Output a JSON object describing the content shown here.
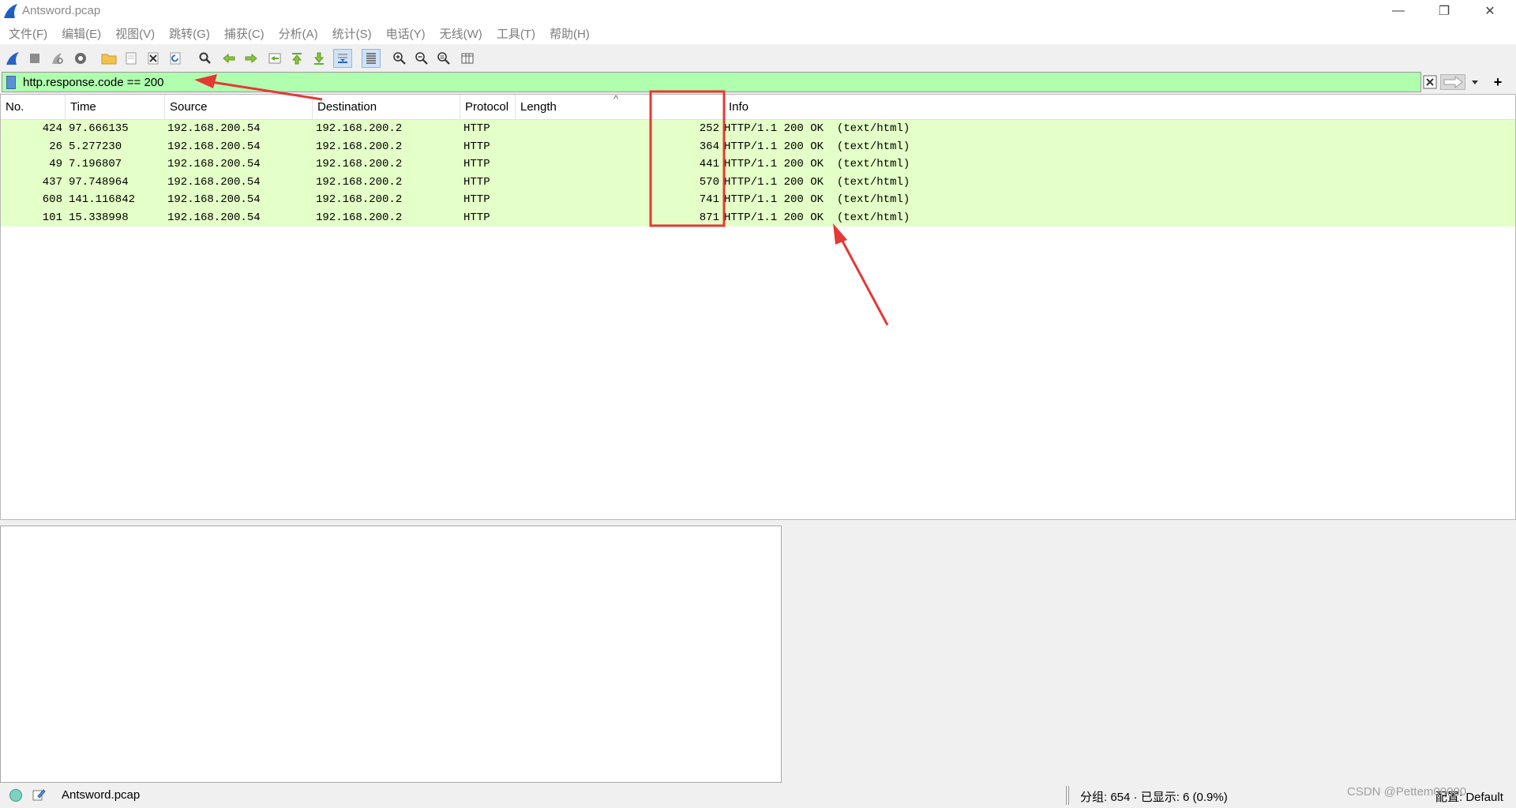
{
  "window": {
    "title": "Antsword.pcap",
    "minimize_glyph": "—",
    "maximize_glyph": "❐",
    "close_glyph": "✕"
  },
  "menu": [
    "文件(F)",
    "编辑(E)",
    "视图(V)",
    "跳转(G)",
    "捕获(C)",
    "分析(A)",
    "统计(S)",
    "电话(Y)",
    "无线(W)",
    "工具(T)",
    "帮助(H)"
  ],
  "toolbar": {
    "icons": [
      "shark-fin-start-icon",
      "stop-square-icon",
      "restart-fin-icon",
      "capture-options-gear-icon",
      "open-folder-icon",
      "save-file-icon",
      "close-file-icon",
      "reload-file-icon",
      "find-magnifier-icon",
      "go-back-arrow-icon",
      "go-forward-arrow-icon",
      "go-to-packet-icon",
      "first-packet-icon",
      "last-packet-icon",
      "autoscroll-icon",
      "colorize-icon",
      "zoom-in-icon",
      "zoom-out-icon",
      "normal-size-icon",
      "resize-columns-icon"
    ]
  },
  "filter": {
    "value": "http.response.code == 200",
    "plus_glyph": "+"
  },
  "packet_list": {
    "headers": [
      "No.",
      "Time",
      "Source",
      "Destination",
      "Protocol",
      "Length",
      "Info"
    ],
    "sort_indicator": "^",
    "rows": [
      {
        "no": "424",
        "time": "97.666135",
        "source": "192.168.200.54",
        "destination": "192.168.200.2",
        "protocol": "HTTP",
        "length": "252",
        "info": "HTTP/1.1 200 OK  (text/html)"
      },
      {
        "no": "26",
        "time": "5.277230",
        "source": "192.168.200.54",
        "destination": "192.168.200.2",
        "protocol": "HTTP",
        "length": "364",
        "info": "HTTP/1.1 200 OK  (text/html)"
      },
      {
        "no": "49",
        "time": "7.196807",
        "source": "192.168.200.54",
        "destination": "192.168.200.2",
        "protocol": "HTTP",
        "length": "441",
        "info": "HTTP/1.1 200 OK  (text/html)"
      },
      {
        "no": "437",
        "time": "97.748964",
        "source": "192.168.200.54",
        "destination": "192.168.200.2",
        "protocol": "HTTP",
        "length": "570",
        "info": "HTTP/1.1 200 OK  (text/html)"
      },
      {
        "no": "608",
        "time": "141.116842",
        "source": "192.168.200.54",
        "destination": "192.168.200.2",
        "protocol": "HTTP",
        "length": "741",
        "info": "HTTP/1.1 200 OK  (text/html)"
      },
      {
        "no": "101",
        "time": "15.338998",
        "source": "192.168.200.54",
        "destination": "192.168.200.2",
        "protocol": "HTTP",
        "length": "871",
        "info": "HTTP/1.1 200 OK  (text/html)"
      }
    ]
  },
  "status": {
    "file": "Antsword.pcap",
    "packets": "分组: 654 · 已显示: 6 (0.9%)",
    "profile": "配置: Default",
    "watermark": "CSDN @Pettem00000"
  },
  "colors": {
    "row_bg": "#e4ffc7",
    "filter_bg": "#afffaf",
    "annotation": "#e53935"
  }
}
